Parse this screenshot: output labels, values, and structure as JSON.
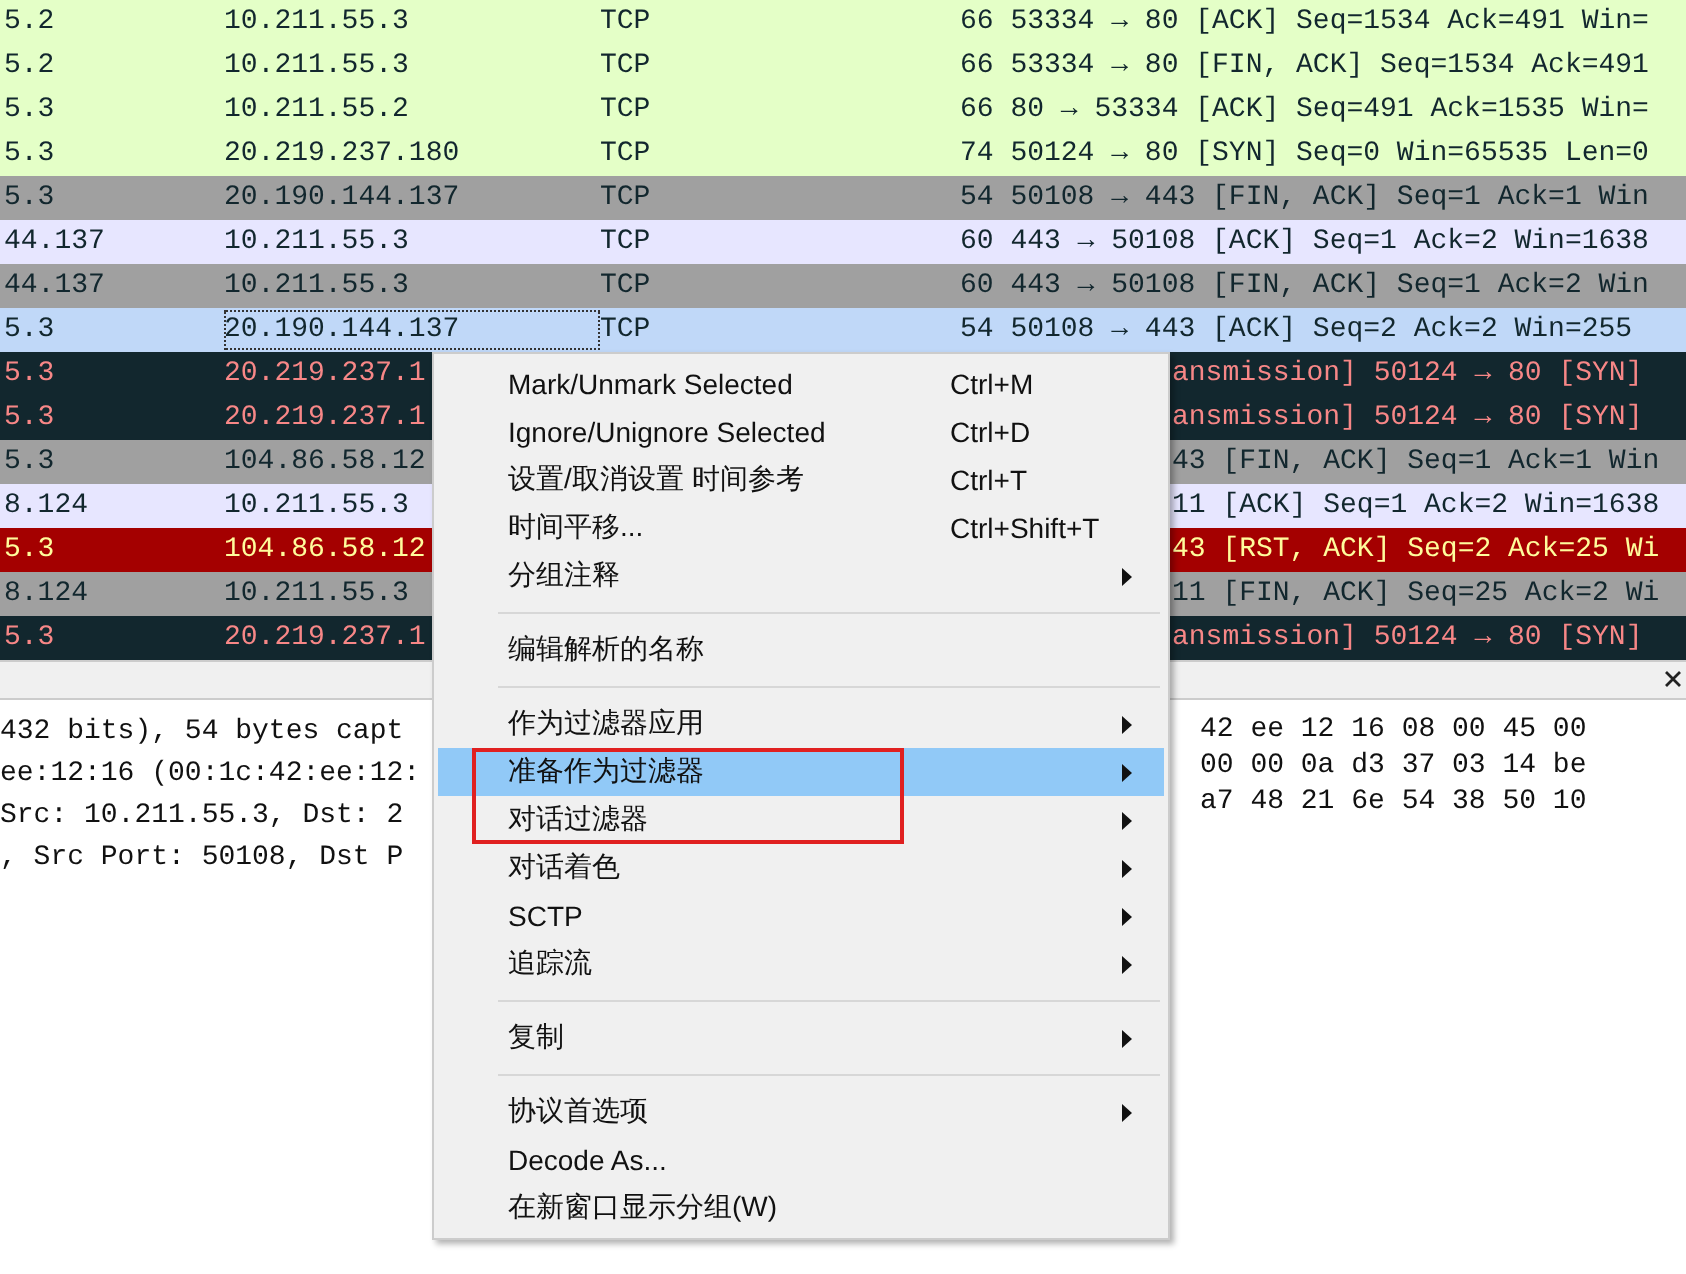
{
  "packet_list": {
    "rows": [
      {
        "kind": "full",
        "color": "#e4ffc7",
        "text": {
          "color": "#12272e"
        },
        "selected": false,
        "source": "5.2",
        "destination": "10.211.55.3",
        "protocol": "TCP",
        "info": "66 53334 → 80 [ACK] Seq=1534 Ack=491 Win="
      },
      {
        "kind": "full",
        "color": "#e4ffc7",
        "text": {
          "color": "#12272e"
        },
        "selected": false,
        "source": "5.2",
        "destination": "10.211.55.3",
        "protocol": "TCP",
        "info": "66 53334 → 80 [FIN, ACK] Seq=1534 Ack=491"
      },
      {
        "kind": "full",
        "color": "#e4ffc7",
        "text": {
          "color": "#12272e"
        },
        "selected": false,
        "source": "5.3",
        "destination": "10.211.55.2",
        "protocol": "TCP",
        "info": "66 80 → 53334 [ACK] Seq=491 Ack=1535 Win="
      },
      {
        "kind": "full",
        "color": "#e4ffc7",
        "text": {
          "color": "#12272e"
        },
        "selected": false,
        "source": "5.3",
        "destination": "20.219.237.180",
        "protocol": "TCP",
        "info": "74 50124 → 80 [SYN] Seq=0 Win=65535 Len=0"
      },
      {
        "kind": "full",
        "color": "#a0a0a0",
        "text": {
          "color": "#12272e"
        },
        "selected": false,
        "source": "5.3",
        "destination": "20.190.144.137",
        "protocol": "TCP",
        "info": "54 50108 → 443 [FIN, ACK] Seq=1 Ack=1 Win"
      },
      {
        "kind": "full",
        "color": "#e7e6ff",
        "text": {
          "color": "#12272e"
        },
        "selected": false,
        "source": "44.137",
        "destination": "10.211.55.3",
        "protocol": "TCP",
        "info": "60 443 → 50108 [ACK] Seq=1 Ack=2 Win=1638"
      },
      {
        "kind": "full",
        "color": "#a0a0a0",
        "text": {
          "color": "#12272e"
        },
        "selected": false,
        "source": "44.137",
        "destination": "10.211.55.3",
        "protocol": "TCP",
        "info": "60 443 → 50108 [FIN, ACK] Seq=1 Ack=2 Win"
      },
      {
        "kind": "full",
        "color": "#c0d8f8",
        "text": {
          "color": "#12272e"
        },
        "selected": true,
        "source": "5.3",
        "destination": "20.190.144.137",
        "protocol": "TCP",
        "info": "54 50108 → 443 [ACK] Seq=2 Ack=2 Win=255"
      },
      {
        "kind": "covered",
        "color": "#12272e",
        "text": {
          "color": "#f78787"
        },
        "selected": false,
        "source": "5.3",
        "destination": "20.219.237.1",
        "info": "ansmission] 50124 → 80 [SYN]"
      },
      {
        "kind": "covered",
        "color": "#12272e",
        "text": {
          "color": "#f78787"
        },
        "selected": false,
        "source": "5.3",
        "destination": "20.219.237.1",
        "info": "ansmission] 50124 → 80 [SYN]"
      },
      {
        "kind": "covered",
        "color": "#a0a0a0",
        "text": {
          "color": "#12272e"
        },
        "selected": false,
        "source": "5.3",
        "destination": "104.86.58.12",
        "info": "43 [FIN, ACK] Seq=1 Ack=1 Win"
      },
      {
        "kind": "covered",
        "color": "#e7e6ff",
        "text": {
          "color": "#12272e"
        },
        "selected": false,
        "source": "8.124",
        "destination": "10.211.55.3",
        "info": "11 [ACK] Seq=1 Ack=2 Win=1638"
      },
      {
        "kind": "covered",
        "color": "#a40000",
        "text": {
          "color": "#fffc9c"
        },
        "selected": false,
        "source": "5.3",
        "destination": "104.86.58.12",
        "info": "43 [RST, ACK] Seq=2 Ack=25 Wi"
      },
      {
        "kind": "covered",
        "color": "#a0a0a0",
        "text": {
          "color": "#12272e"
        },
        "selected": false,
        "source": "8.124",
        "destination": "10.211.55.3",
        "info": "11 [FIN, ACK] Seq=25 Ack=2 Wi"
      },
      {
        "kind": "covered",
        "color": "#12272e",
        "text": {
          "color": "#f78787"
        },
        "selected": false,
        "source": "5.3",
        "destination": "20.219.237.1",
        "info": "ansmission] 50124 → 80 [SYN]"
      }
    ]
  },
  "details": [
    "432 bits), 54 bytes capt",
    "ee:12:16 (00:1c:42:ee:12:",
    "Src: 10.211.55.3, Dst: 2",
    ", Src Port: 50108, Dst P"
  ],
  "bytes": [
    "42 ee 12 16 08 00 45 00",
    "00 00 0a d3 37 03 14 be",
    "a7 48 21 6e 54 38 50 10"
  ],
  "context_menu": {
    "groups": [
      [
        {
          "label": "Mark/Unmark Selected",
          "shortcut": "Ctrl+M",
          "submenu": false,
          "selected": false
        },
        {
          "label": "Ignore/Unignore Selected",
          "shortcut": "Ctrl+D",
          "submenu": false,
          "selected": false
        },
        {
          "label": "设置/取消设置 时间参考",
          "shortcut": "Ctrl+T",
          "submenu": false,
          "selected": false
        },
        {
          "label": "时间平移...",
          "shortcut": "Ctrl+Shift+T",
          "submenu": false,
          "selected": false
        },
        {
          "label": "分组注释",
          "submenu": true,
          "selected": false
        }
      ],
      [
        {
          "label": "编辑解析的名称",
          "submenu": false,
          "selected": false
        }
      ],
      [
        {
          "label": "作为过滤器应用",
          "submenu": true,
          "selected": false
        },
        {
          "label": "准备作为过滤器",
          "submenu": true,
          "selected": true
        },
        {
          "label": "对话过滤器",
          "submenu": true,
          "selected": false
        },
        {
          "label": "对话着色",
          "submenu": true,
          "selected": false
        },
        {
          "label": "SCTP",
          "submenu": true,
          "selected": false
        },
        {
          "label": "追踪流",
          "submenu": true,
          "selected": false
        }
      ],
      [
        {
          "label": "复制",
          "submenu": true,
          "selected": false
        }
      ],
      [
        {
          "label": "协议首选项",
          "submenu": true,
          "selected": false
        },
        {
          "label": "Decode As...",
          "submenu": false,
          "selected": false
        },
        {
          "label": "在新窗口显示分组(W)",
          "submenu": false,
          "selected": false
        }
      ]
    ]
  }
}
